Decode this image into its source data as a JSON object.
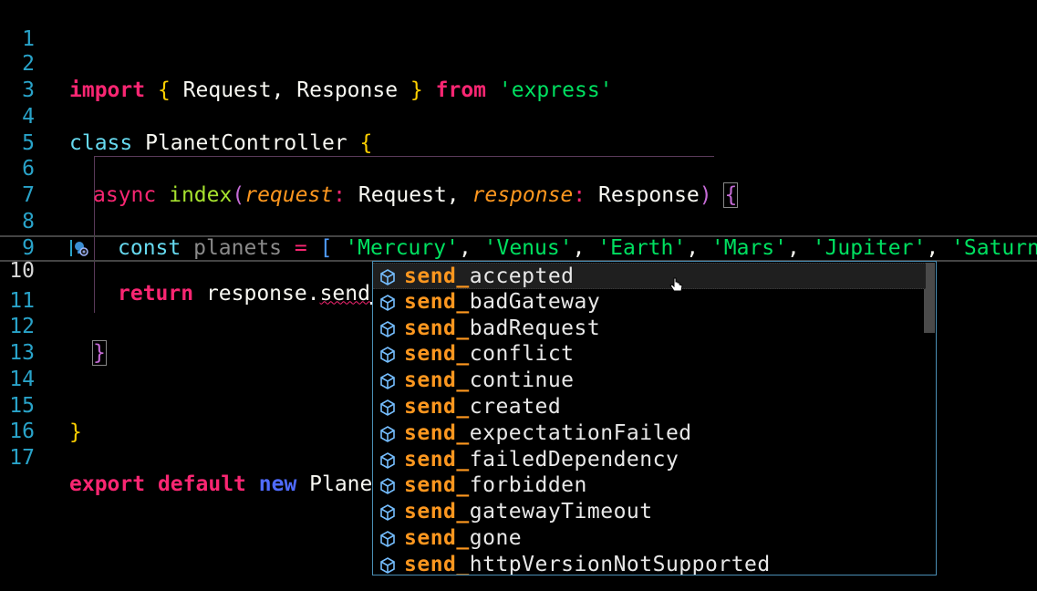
{
  "editor": {
    "lines": [
      {
        "num": "1"
      },
      {
        "num": "2"
      },
      {
        "num": "3"
      },
      {
        "num": "4"
      },
      {
        "num": "5"
      },
      {
        "num": "6"
      },
      {
        "num": "7"
      },
      {
        "num": "8"
      },
      {
        "num": "9"
      },
      {
        "num": "10"
      },
      {
        "num": "11"
      },
      {
        "num": "12"
      },
      {
        "num": "13"
      },
      {
        "num": "14"
      },
      {
        "num": "15"
      },
      {
        "num": "16"
      },
      {
        "num": "17"
      }
    ],
    "tokens": {
      "import_kw": "import",
      "brace_open": "{",
      "import_names": " Request, Response ",
      "brace_close": "}",
      "from_kw": "from",
      "module": "'express'",
      "class_kw": "class",
      "class_name": " PlanetController ",
      "class_brace": "{",
      "async_kw": "async",
      "method_name": "index",
      "paren_open": "(",
      "param1": "request",
      "colon1": ": ",
      "type1": "Request",
      "comma1": ", ",
      "param2": "response",
      "colon2": ": ",
      "type2": "Response",
      "paren_close": ")",
      "method_brace": "{",
      "const_kw": "const",
      "var_name": " planets ",
      "eq": "=",
      "arr_open": "[",
      "s1": "'Mercury'",
      "s2": "'Venus'",
      "s3": "'Earth'",
      "s4": "'Mars'",
      "s5": "'Jupiter'",
      "s6": "'Saturn'",
      "comma": ", ",
      "return_kw": "return",
      "return_obj": " response.",
      "return_prop": "send",
      "method_brace_close": "}",
      "class_brace_close": "}",
      "export_kw": "export",
      "default_kw": "default",
      "new_kw": "new",
      "export_name": " Planet"
    }
  },
  "suggest": {
    "match": "send_",
    "items": [
      {
        "rest": "accepted"
      },
      {
        "rest": "badGateway"
      },
      {
        "rest": "badRequest"
      },
      {
        "rest": "conflict"
      },
      {
        "rest": "continue"
      },
      {
        "rest": "created"
      },
      {
        "rest": "expectationFailed"
      },
      {
        "rest": "failedDependency"
      },
      {
        "rest": "forbidden"
      },
      {
        "rest": "gatewayTimeout"
      },
      {
        "rest": "gone"
      },
      {
        "rest": "httpVersionNotSupported"
      }
    ],
    "icon": "property-cube-icon"
  },
  "colors": {
    "background": "#000000",
    "line_number": "#29a3c9",
    "keyword": "#f92672",
    "string": "#00e060",
    "brace": "#ffd000",
    "param": "#fd971f",
    "suggest_border": "#4a8fb5",
    "match": "#fd971f"
  }
}
